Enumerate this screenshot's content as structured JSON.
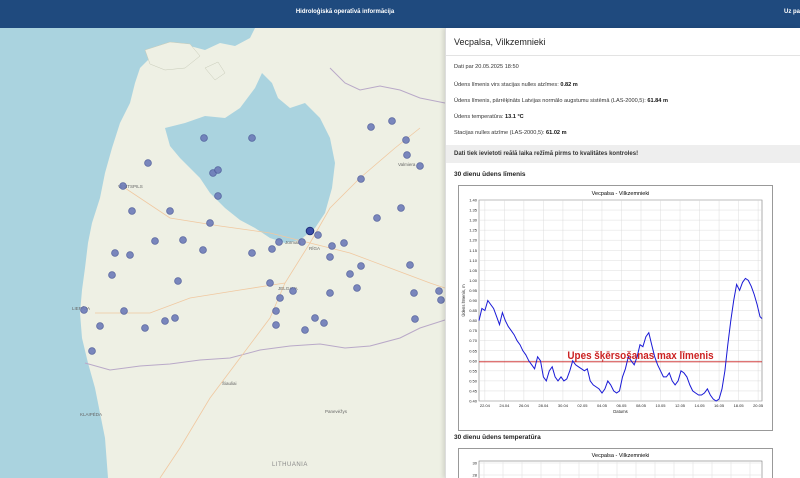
{
  "header": {
    "title": "Hidroloģiskā operatīvā informācija",
    "right_text": "Uz pa"
  },
  "map": {
    "labels": {
      "ventspils": "VENTSPILS",
      "liepaja": "LIEPĀJA",
      "riga": "RĪGA",
      "jurmala": "Jūrmala",
      "jelgava": "JELGAVA",
      "klaipeda": "KLAIPĖDA",
      "siauliai": "Šiauliai",
      "panevezys": "Panevėžys",
      "lithuania": "LITHUANIA",
      "valmiera": "Valmiera"
    }
  },
  "panel": {
    "station_name": "Vecpalsa, Vilkzemnieki",
    "date_label": "Dati par 20.05.2025 18:50",
    "level_label": "Ūdens līmenis virs stacijas nulles atzīmes:",
    "level_value": "0.82 m",
    "level_las_label": "Ūdens līmenis, pārrēķināts Latvijas normālo augstumu sistēmā (LAS-2000,5):",
    "level_las_value": "61.84 m",
    "temp_label": "Ūdens temperatūra:",
    "temp_value": "13.1 °C",
    "zero_label": "Stacijas nulles atzīme (LAS-2000,5):",
    "zero_value": "61.02 m",
    "warning": "Dati tiek ievietoti reālā laika režīmā pirms to kvalitātes kontroles!",
    "section_level": "30 dienu ūdens līmenis",
    "section_temp": "30 dienu ūdens temperatūra"
  },
  "chart_data": [
    {
      "type": "line",
      "title": "Vecpalsa - Vilkzemnieki",
      "xlabel": "Datums",
      "ylabel": "Ūdens līmenis, m",
      "x_ticks": [
        "22.04",
        "24.04",
        "26.04",
        "28.04",
        "30.04",
        "02.05",
        "04.05",
        "06.05",
        "08.05",
        "10.05",
        "12.05",
        "14.05",
        "16.05",
        "18.05",
        "20.05"
      ],
      "y_ticks": [
        "0.40",
        "0.45",
        "0.50",
        "0.55",
        "0.60",
        "0.65",
        "0.70",
        "0.75",
        "0.80",
        "0.85",
        "0.90",
        "0.95",
        "1.00",
        "1.05",
        "1.10",
        "1.15",
        "1.20",
        "1.25",
        "1.30",
        "1.35",
        "1.40"
      ],
      "ylim": [
        0.4,
        1.4
      ],
      "xlim_days": [
        0,
        29
      ],
      "grid": true,
      "threshold": {
        "value": 0.595,
        "label": "Upes šķērsošanas max līmenis",
        "color": "#cc2222"
      },
      "series": [
        {
          "color": "#1a1ad6",
          "x": [
            0,
            0.3,
            0.6,
            0.9,
            1.2,
            1.5,
            1.8,
            2.1,
            2.4,
            2.7,
            3.0,
            3.3,
            3.6,
            3.9,
            4.2,
            4.5,
            4.8,
            5.1,
            5.4,
            5.7,
            6.0,
            6.3,
            6.6,
            6.9,
            7.2,
            7.5,
            7.8,
            8.1,
            8.4,
            8.7,
            9.0,
            9.3,
            9.6,
            9.9,
            10.2,
            10.5,
            10.8,
            11.1,
            11.4,
            11.7,
            12.0,
            12.3,
            12.6,
            12.9,
            13.2,
            13.5,
            13.8,
            14.1,
            14.4,
            14.7,
            15.0,
            15.3,
            15.6,
            15.9,
            16.2,
            16.5,
            16.8,
            17.1,
            17.4,
            17.7,
            18.0,
            18.3,
            18.6,
            18.9,
            19.2,
            19.5,
            19.8,
            20.1,
            20.4,
            20.7,
            21.0,
            21.3,
            21.6,
            21.9,
            22.2,
            22.5,
            22.8,
            23.1,
            23.4,
            23.7,
            24.0,
            24.3,
            24.6,
            24.9,
            25.2,
            25.5,
            25.8,
            26.1,
            26.4,
            26.7,
            27.0,
            27.3,
            27.6,
            27.9,
            28.2,
            28.5,
            28.8,
            29.0
          ],
          "y": [
            0.8,
            0.86,
            0.85,
            0.9,
            0.88,
            0.86,
            0.82,
            0.78,
            0.84,
            0.8,
            0.77,
            0.75,
            0.73,
            0.7,
            0.68,
            0.65,
            0.63,
            0.6,
            0.58,
            0.56,
            0.62,
            0.6,
            0.52,
            0.5,
            0.55,
            0.57,
            0.52,
            0.5,
            0.52,
            0.5,
            0.51,
            0.55,
            0.6,
            0.58,
            0.57,
            0.56,
            0.55,
            0.56,
            0.5,
            0.48,
            0.47,
            0.46,
            0.44,
            0.46,
            0.5,
            0.48,
            0.45,
            0.44,
            0.45,
            0.52,
            0.56,
            0.62,
            0.6,
            0.58,
            0.62,
            0.68,
            0.67,
            0.72,
            0.74,
            0.68,
            0.62,
            0.58,
            0.55,
            0.52,
            0.52,
            0.54,
            0.5,
            0.48,
            0.5,
            0.55,
            0.54,
            0.52,
            0.48,
            0.45,
            0.44,
            0.43,
            0.43,
            0.44,
            0.46,
            0.43,
            0.41,
            0.4,
            0.41,
            0.46,
            0.55,
            0.68,
            0.8,
            0.9,
            0.98,
            0.95,
            0.99,
            1.01,
            1.0,
            0.97,
            0.93,
            0.88,
            0.82,
            0.81
          ]
        }
      ]
    },
    {
      "type": "line",
      "title": "Vecpalsa - Vilkzemnieki",
      "y_ticks": [
        "30",
        "28",
        "26"
      ],
      "series": []
    }
  ]
}
